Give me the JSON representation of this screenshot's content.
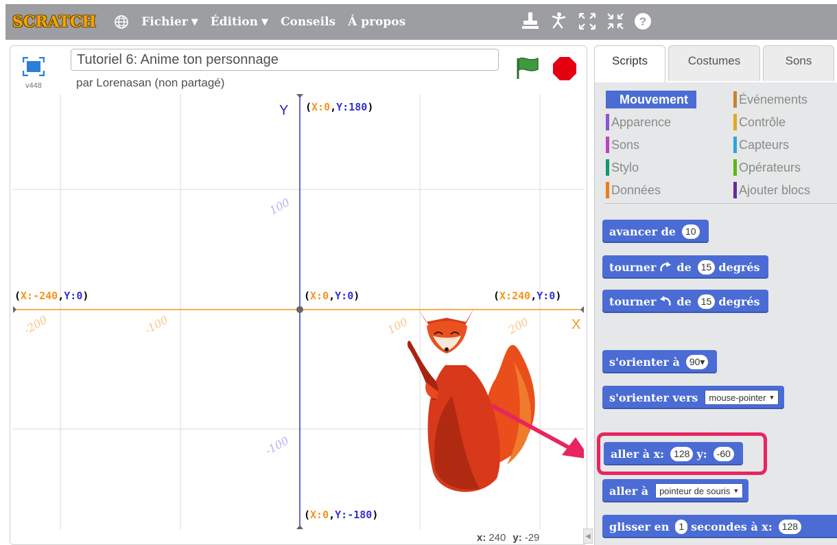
{
  "app": {
    "logo": "SCRATCH",
    "menu": [
      {
        "label": "Fichier",
        "has_caret": true
      },
      {
        "label": "Édition",
        "has_caret": true
      },
      {
        "label": "Conseils",
        "has_caret": false
      },
      {
        "label": "Á propos",
        "has_caret": false
      }
    ],
    "menubar_color": "#9c9ea2",
    "logo_color": "#f7a400"
  },
  "stage": {
    "project_title": "Tutoriel 6: Anime ton personnage",
    "byline": "par Lorenasan (non partagé)",
    "version": "v448",
    "coords": {
      "x_label": "x:",
      "x_value": "240",
      "y_label": "y:",
      "y_value": "-29"
    },
    "axis_labels": {
      "y": "Y",
      "x": "X"
    },
    "point_labels": {
      "top": {
        "xk": "X:",
        "xv": "0",
        "yk": "Y:",
        "yv": "180"
      },
      "left": {
        "xk": "X:",
        "xv": "-240",
        "yk": "Y:",
        "yv": "0"
      },
      "center": {
        "xk": "X:",
        "xv": "0",
        "yk": "Y:",
        "yv": "0"
      },
      "right": {
        "xk": "X:",
        "xv": "240",
        "yk": "Y:",
        "yv": "0"
      },
      "bottom": {
        "xk": "X:",
        "xv": "0",
        "yk": "Y:",
        "yv": "-180"
      }
    },
    "tick_labels": {
      "x_neg200": "-200",
      "x_neg100": "-100",
      "x_100": "100",
      "x_200": "200",
      "y_100": "100",
      "y_neg100": "-100"
    },
    "colors": {
      "x_axis": "#f7931e",
      "y_axis": "#3333cc",
      "grid": "#d8d8d8",
      "accent": "#e8255f"
    }
  },
  "palette": {
    "tabs": [
      {
        "label": "Scripts",
        "active": true
      },
      {
        "label": "Costumes",
        "active": false
      },
      {
        "label": "Sons",
        "active": false
      }
    ],
    "categories": [
      {
        "label": "Mouvement",
        "color": "#4a6cd4",
        "active": true
      },
      {
        "label": "Événements",
        "color": "#c88330",
        "active": false
      },
      {
        "label": "Apparence",
        "color": "#8a55d7",
        "active": false
      },
      {
        "label": "Contrôle",
        "color": "#e1a91a",
        "active": false
      },
      {
        "label": "Sons",
        "color": "#bb42c3",
        "active": false
      },
      {
        "label": "Capteurs",
        "color": "#2ca5e2",
        "active": false
      },
      {
        "label": "Stylo",
        "color": "#0e9a6c",
        "active": false
      },
      {
        "label": "Opérateurs",
        "color": "#5cb712",
        "active": false
      },
      {
        "label": "Données",
        "color": "#ee7d16",
        "active": false
      },
      {
        "label": "Ajouter blocs",
        "color": "#632d99",
        "active": false
      }
    ],
    "blocks": {
      "move": {
        "text": "avancer de",
        "value": "10"
      },
      "turn_right": {
        "text": "tourner",
        "mid": "de",
        "value": "15",
        "end": "degrés"
      },
      "turn_left": {
        "text": "tourner",
        "mid": "de",
        "value": "15",
        "end": "degrés"
      },
      "point_dir": {
        "text": "s'orienter à",
        "value": "90▾"
      },
      "point_towards": {
        "text": "s'orienter vers",
        "option": "mouse-pointer"
      },
      "goto_xy": {
        "text": "aller à x:",
        "x": "128",
        "ylabel": "y:",
        "y": "-60"
      },
      "goto": {
        "text": "aller à",
        "option": "pointeur de souris"
      },
      "glide": {
        "text": "glisser en",
        "secs": "1",
        "mid": "secondes à x:",
        "x": "128"
      }
    },
    "block_color": "#4a6cd4"
  }
}
